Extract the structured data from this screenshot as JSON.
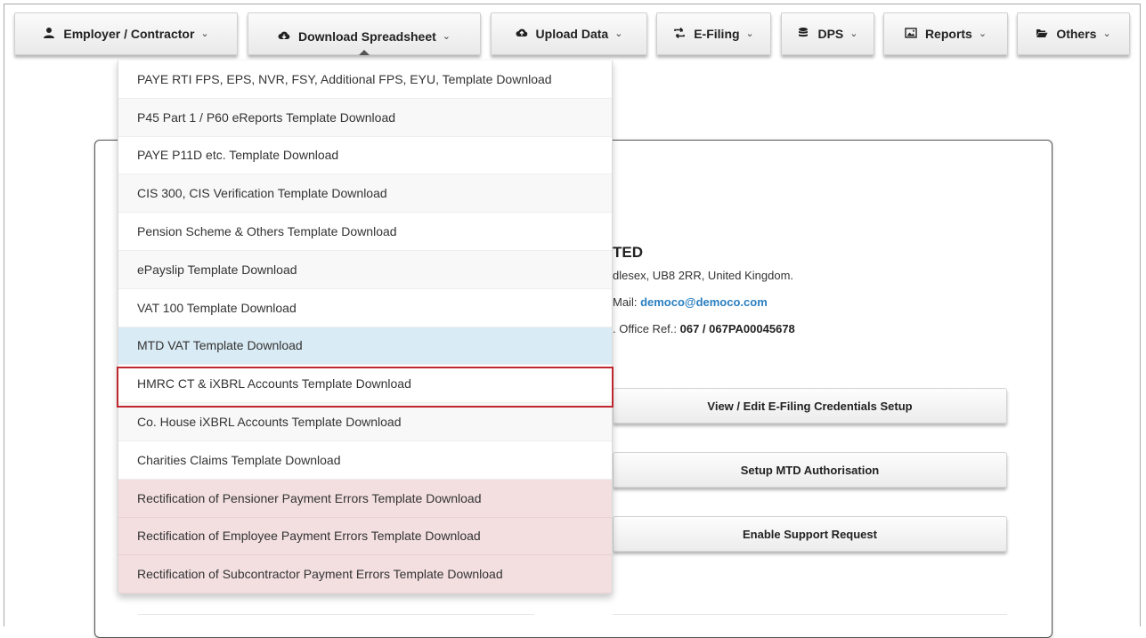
{
  "nav": {
    "employer": "Employer / Contractor",
    "download": "Download Spreadsheet",
    "upload": "Upload Data",
    "efiling": "E-Filing",
    "dps": "DPS",
    "reports": "Reports",
    "others": "Others"
  },
  "dropdown": {
    "items": [
      "PAYE RTI FPS, EPS, NVR, FSY, Additional FPS, EYU, Template Download",
      "P45 Part 1 / P60 eReports Template Download",
      "PAYE P11D etc. Template Download",
      "CIS 300, CIS Verification Template Download",
      "Pension Scheme & Others Template Download",
      "ePayslip Template Download",
      "VAT 100 Template Download",
      "MTD VAT Template Download",
      "HMRC CT & iXBRL Accounts Template Download",
      "Co. House iXBRL Accounts Template Download",
      "Charities Claims Template Download",
      "Rectification of Pensioner Payment Errors Template Download",
      "Rectification of Employee Payment Errors Template Download",
      "Rectification of Subcontractor Payment Errors Template Download"
    ],
    "hovered_item": "MTD VAT Template Download",
    "highlighted_item": "HMRC CT & iXBRL Accounts Template Download"
  },
  "company": {
    "name_partial": "TED",
    "address_partial": "dlesex, UB8 2RR, United Kingdom.",
    "email_label_partial": "Mail: ",
    "email": "democo@democo.com",
    "office_label_partial": ". Office Ref.: ",
    "office_ref": "067 / 067PA00045678"
  },
  "actions": {
    "credentials": "View / Edit E-Filing Credentials Setup",
    "mtd": "Setup MTD Authorisation",
    "support": "Enable Support Request"
  },
  "colors": {
    "hover_bg": "#d9ebf4",
    "pink_bg": "#f3dfe0",
    "highlight_border": "#c0262d",
    "email_link": "#2a7fc1"
  }
}
